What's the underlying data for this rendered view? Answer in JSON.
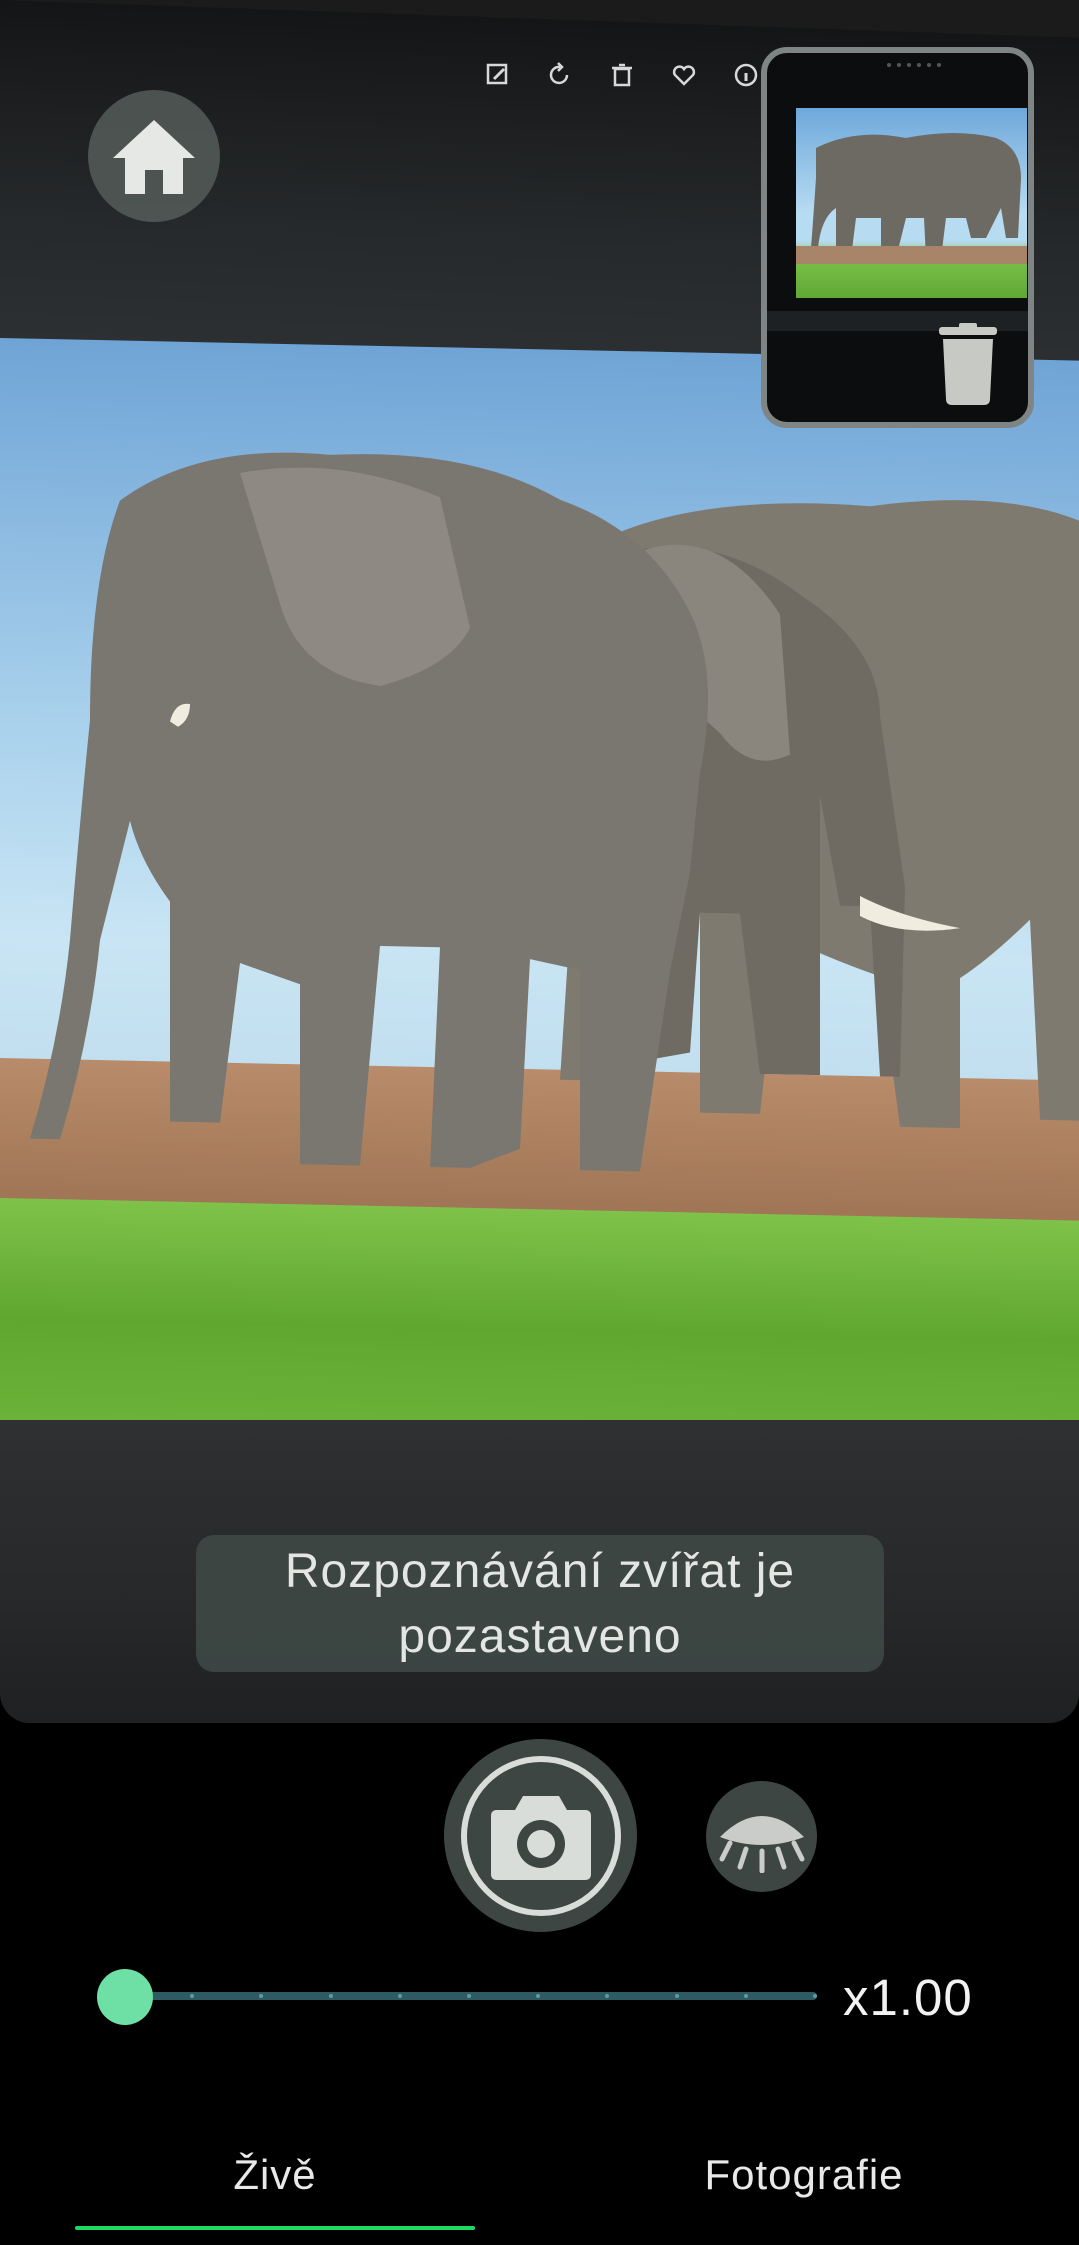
{
  "colors": {
    "accent": "#6ee0a5",
    "tab_indicator": "#1fd764",
    "button_bg": "#3e4643",
    "toast_bg": "#3e4844"
  },
  "icons": {
    "home": "home-icon",
    "trash": "trash-icon",
    "camera": "camera-icon",
    "detection": "eye-closed-icon",
    "toolbar": [
      "edit-icon",
      "rotate-icon",
      "delete-icon",
      "heart-icon",
      "info-icon"
    ]
  },
  "toast": {
    "line1": "Rozpoznávání zvířat je",
    "line2": "pozastaveno"
  },
  "zoom": {
    "label": "x1.00",
    "value": 0,
    "ticks": 10
  },
  "nav": {
    "tabs": [
      {
        "label": "Živě",
        "active": true
      },
      {
        "label": "Fotografie",
        "active": false
      }
    ]
  }
}
